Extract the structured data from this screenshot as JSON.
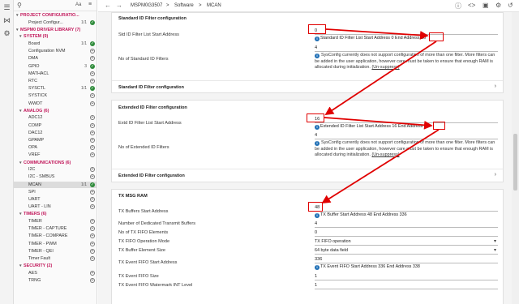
{
  "topbar": {
    "back_icon": "arrow-left-icon",
    "forward_icon": "arrow-right-icon",
    "project": "MSPM0G3507",
    "sep1": ">",
    "software": "Software",
    "sep2": ">",
    "module": "MCAN",
    "right_icons": [
      "info-icon",
      "code-icon",
      "cpu-icon",
      "gear-icon",
      "history-icon"
    ]
  },
  "sidebar": {
    "search_icon": "search-icon",
    "aa_label": "Aa",
    "filter_icon": "filter-icon",
    "rows": [
      {
        "type": "header",
        "label": "PROJECT CONFIGURATIO...",
        "chevron": "v"
      },
      {
        "type": "item",
        "label": "Project Configur...",
        "count": "1/1",
        "status": "check"
      },
      {
        "type": "header",
        "label": "MSPM0 DRIVER LIBRARY (7)",
        "chevron": "v"
      },
      {
        "type": "header",
        "label": "SYSTEM (9)",
        "chevron": "v"
      },
      {
        "type": "item",
        "label": "Board",
        "count": "1/1",
        "status": "check"
      },
      {
        "type": "item",
        "label": "Configuration NVM",
        "count": "",
        "status": "add"
      },
      {
        "type": "item",
        "label": "DMA",
        "count": "",
        "status": "add"
      },
      {
        "type": "item",
        "label": "GPIO",
        "count": "3",
        "status": "check"
      },
      {
        "type": "item",
        "label": "MATHACL",
        "count": "",
        "status": "add"
      },
      {
        "type": "item",
        "label": "RTC",
        "count": "",
        "status": "add"
      },
      {
        "type": "item",
        "label": "SYSCTL",
        "count": "1/1",
        "status": "check"
      },
      {
        "type": "item",
        "label": "SYSTICK",
        "count": "",
        "status": "add"
      },
      {
        "type": "item",
        "label": "WWDT",
        "count": "",
        "status": "add"
      },
      {
        "type": "header",
        "label": "ANALOG (6)",
        "chevron": "v"
      },
      {
        "type": "item",
        "label": "ADC12",
        "count": "",
        "status": "add"
      },
      {
        "type": "item",
        "label": "COMP",
        "count": "",
        "status": "add"
      },
      {
        "type": "item",
        "label": "DAC12",
        "count": "",
        "status": "add"
      },
      {
        "type": "item",
        "label": "GPAMP",
        "count": "",
        "status": "add"
      },
      {
        "type": "item",
        "label": "OPA",
        "count": "",
        "status": "add"
      },
      {
        "type": "item",
        "label": "VREF",
        "count": "",
        "status": "add"
      },
      {
        "type": "header",
        "label": "COMMUNICATIONS (6)",
        "chevron": "v"
      },
      {
        "type": "item",
        "label": "I2C",
        "count": "",
        "status": "add"
      },
      {
        "type": "item",
        "label": "I2C - SMBUS",
        "count": "",
        "status": "add"
      },
      {
        "type": "item",
        "label": "MCAN",
        "count": "1/1",
        "status": "check",
        "selected": true
      },
      {
        "type": "item",
        "label": "SPI",
        "count": "",
        "status": "add"
      },
      {
        "type": "item",
        "label": "UART",
        "count": "",
        "status": "add"
      },
      {
        "type": "item",
        "label": "UART - LIN",
        "count": "",
        "status": "add"
      },
      {
        "type": "header",
        "label": "TIMERS (6)",
        "chevron": "v"
      },
      {
        "type": "item",
        "label": "TIMER",
        "count": "",
        "status": "add"
      },
      {
        "type": "item",
        "label": "TIMER - CAPTURE",
        "count": "",
        "status": "add"
      },
      {
        "type": "item",
        "label": "TIMER - COMPARE",
        "count": "",
        "status": "add"
      },
      {
        "type": "item",
        "label": "TIMER - PWM",
        "count": "",
        "status": "add"
      },
      {
        "type": "item",
        "label": "TIMER - QEI",
        "count": "",
        "status": "add"
      },
      {
        "type": "item",
        "label": "Timer Fault",
        "count": "",
        "status": "add"
      },
      {
        "type": "header",
        "label": "SECURITY (2)",
        "chevron": "v"
      },
      {
        "type": "item",
        "label": "AES",
        "count": "",
        "status": "add"
      },
      {
        "type": "item",
        "label": "TRNG",
        "count": "",
        "status": "add"
      }
    ]
  },
  "std": {
    "title": "Standard ID Filter configuration",
    "start_label": "Std ID Filter List Start Address",
    "start_value": "0",
    "start_info": "Standard ID Filter List Start Address 0 End Address 16",
    "num_label": "No of Standard ID Filters",
    "num_value": "4",
    "note": "SysConfig currently does not support configuration of more than one filter. More filters can be added in the user application, however care must be taken to ensure that enough RAM is allocated during initialization.",
    "note_link": "(Un-suppress)",
    "sub_title": "Standard ID Filter configuration"
  },
  "ext": {
    "title": "Extended ID Filter configuration",
    "start_label": "Extd ID Filter List Start Address",
    "start_value": "16",
    "start_info": "Extended ID Filter List Start Address 16 End Address 48",
    "num_label": "No of Extended ID Filters",
    "num_value": "4",
    "note": "SysConfig currently does not support configuration of more than one filter. More filters can be added in the user application, however care must be taken to ensure that enough RAM is allocated during initialization.",
    "note_link": "(Un-suppress)",
    "sub_title": "Extended ID Filter configuration"
  },
  "tx": {
    "title": "TX MSG RAM",
    "buf_start_label": "TX Buffers Start Address",
    "buf_start_value": "48",
    "buf_start_info": "TX Buffer Start Address 48 End Address 336",
    "ded_label": "Number of Dedicated Transmit Buffers",
    "ded_value": "4",
    "fifo_label": "No of TX FIFO Elements",
    "fifo_value": "0",
    "mode_label": "TX FIFO Operation Mode",
    "mode_value": "TX FIFO operation",
    "elsize_label": "TX Buffer Element Size",
    "elsize_value": "64 byte data field",
    "evt_start_label": "TX Event FIFO Start Address",
    "evt_start_value": "336",
    "evt_start_info": "TX Event FIFO Start Address 336 End Address 338",
    "evt_size_label": "TX Event FIFO Size",
    "evt_size_value": "1",
    "evt_wm_label": "TX Event FIFO Watermark INT Level",
    "evt_wm_value": "1"
  },
  "colors": {
    "accent": "#c2185b",
    "annotation": "#e00000",
    "check": "#2e8b3a",
    "info": "#1f6fb5"
  }
}
